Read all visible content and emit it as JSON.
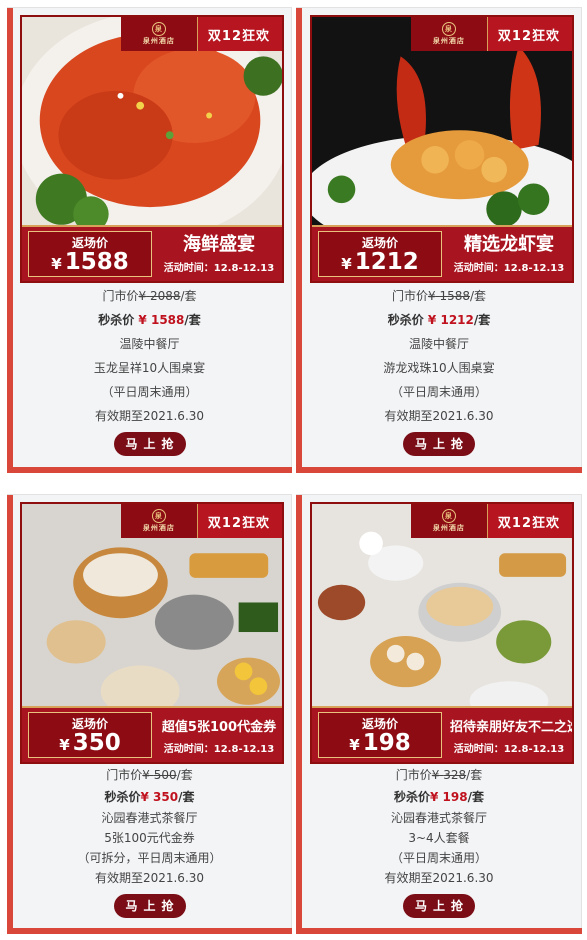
{
  "promo_tag": "双12狂欢",
  "hotel_seal_mark": "泉",
  "hotel_name": "泉州酒店",
  "price_label": "返场价",
  "currency": "¥",
  "buy_label": "马上抢",
  "brand_color": "#b71520",
  "accent_color": "#d9463a",
  "cards": [
    {
      "title": "海鲜盛宴",
      "date": "活动时间：12.8-12.13",
      "price": "1588",
      "market_label": "门市价",
      "market_price": "2088",
      "unit": "/套",
      "deal_label": "秒杀价",
      "deal_price": "1588",
      "venue": "温陵中餐厅",
      "package": "玉龙呈祥10人围桌宴",
      "note": "（平日周末通用）",
      "valid": "有效期至2021.6.30"
    },
    {
      "title": "精选龙虾宴",
      "date": "活动时间：12.8-12.13",
      "price": "1212",
      "market_label": "门市价",
      "market_price": "1588",
      "unit": "/套",
      "deal_label": "秒杀价",
      "deal_price": "1212",
      "venue": "温陵中餐厅",
      "package": "游龙戏珠10人围桌宴",
      "note": "（平日周末通用）",
      "valid": "有效期至2021.6.30"
    },
    {
      "title": "超值5张100代金券",
      "date": "活动时间：12.8-12.13",
      "price": "350",
      "market_label": "门市价",
      "market_price": "500",
      "unit": "/套",
      "deal_label": "秒杀价",
      "deal_price": "350",
      "venue": "沁园春港式茶餐厅",
      "package": "5张100元代金券",
      "note": "（可拆分，平日周末通用）",
      "valid": "有效期至2021.6.30"
    },
    {
      "title": "招待亲朋好友不二之选",
      "date": "活动时间：12.8-12.13",
      "price": "198",
      "market_label": "门市价",
      "market_price": "328",
      "unit": "/套",
      "deal_label": "秒杀价",
      "deal_price": "198",
      "venue": "沁园春港式茶餐厅",
      "package": "3~4人套餐",
      "note": "（平日周末通用）",
      "valid": "有效期至2021.6.30"
    }
  ]
}
